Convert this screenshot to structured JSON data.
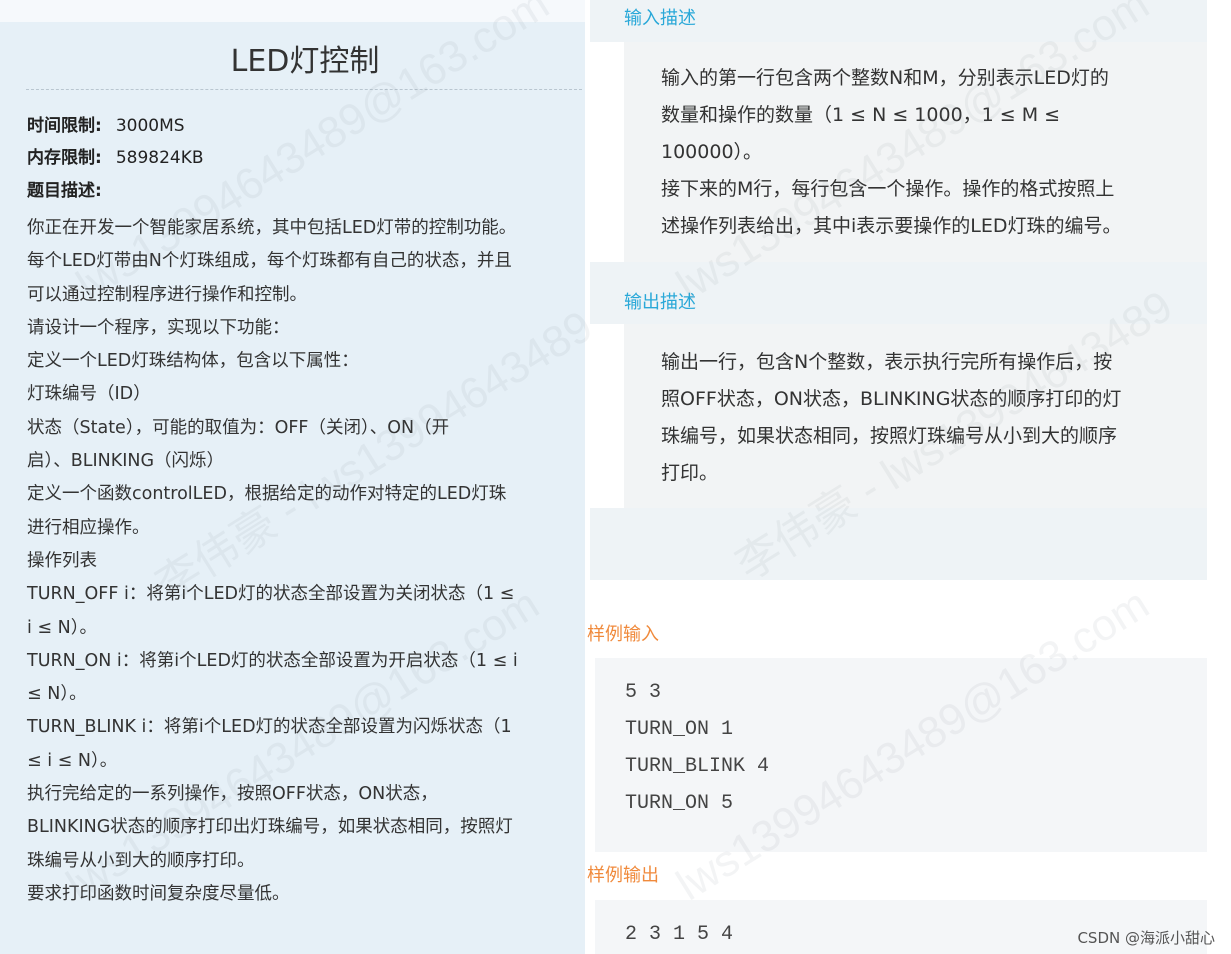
{
  "problem": {
    "title": "LED灯控制",
    "time_limit_label": "时间限制:",
    "time_limit_value": "3000MS",
    "memory_limit_label": "内存限制:",
    "memory_limit_value": "589824KB",
    "desc_label": "题目描述:"
  },
  "description_lines": [
    "你正在开发一个智能家居系统，其中包括LED灯带的控制功能。",
    "每个LED灯带由N个灯珠组成，每个灯珠都有自己的状态，并且",
    "可以通过控制程序进行操作和控制。",
    "请设计一个程序，实现以下功能：",
    "定义一个LED灯珠结构体，包含以下属性：",
    "灯珠编号（ID）",
    "状态（State），可能的取值为：OFF（关闭）、ON（开",
    "启）、BLINKING（闪烁）",
    "定义一个函数controlLED，根据给定的动作对特定的LED灯珠",
    "进行相应操作。",
    "操作列表",
    "TURN_OFF i：将第i个LED灯的状态全部设置为关闭状态（1 ≤",
    "i ≤ N）。",
    "TURN_ON i：将第i个LED灯的状态全部设置为开启状态（1 ≤ i",
    "≤ N）。",
    "TURN_BLINK i：将第i个LED灯的状态全部设置为闪烁状态（1",
    "≤ i ≤ N）。",
    "执行完给定的一系列操作，按照OFF状态，ON状态，",
    "BLINKING状态的顺序打印出灯珠编号，如果状态相同，按照灯",
    "珠编号从小到大的顺序打印。",
    "要求打印函数时间复杂度尽量低。"
  ],
  "input_section": {
    "label": "输入描述",
    "lines": [
      "输入的第一行包含两个整数N和M，分别表示LED灯的",
      "数量和操作的数量（1 ≤ N ≤ 1000，1 ≤ M ≤",
      "100000）。",
      "接下来的M行，每行包含一个操作。操作的格式按照上",
      "述操作列表给出，其中i表示要操作的LED灯珠的编号。"
    ]
  },
  "output_section": {
    "label": "输出描述",
    "lines": [
      "输出一行，包含N个整数，表示执行完所有操作后，按",
      "照OFF状态，ON状态，BLINKING状态的顺序打印的灯",
      "珠编号，如果状态相同，按照灯珠编号从小到大的顺序",
      "打印。"
    ]
  },
  "sample_input": {
    "label": "样例输入",
    "lines": [
      "5 3",
      "TURN_ON 1",
      "TURN_BLINK 4",
      "TURN_ON 5"
    ]
  },
  "sample_output": {
    "label": "样例输出",
    "lines": [
      "2 3 1 5 4"
    ]
  },
  "credit": "CSDN @海派小甜心",
  "watermarks": [
    "lws13994643489@163.com",
    "李伟豪 - lws13994643489"
  ],
  "colors": {
    "section_label": "#29a8d8",
    "sample_label": "#f08a3c",
    "left_background": "#e6f0f7"
  }
}
